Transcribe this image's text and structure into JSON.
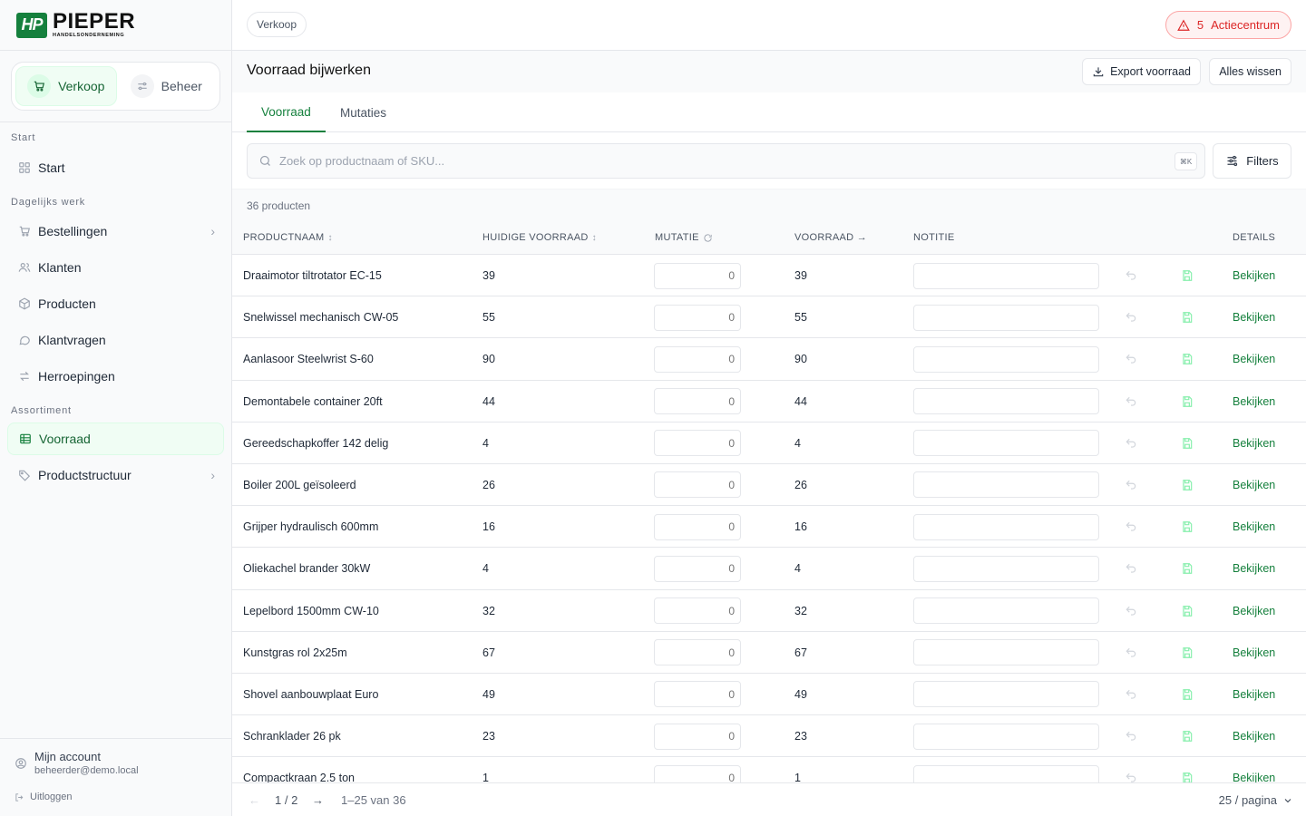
{
  "brand": {
    "mark": "HP",
    "name": "PIEPER",
    "sub": "HANDELSONDERNEMING"
  },
  "modes": [
    {
      "label": "Verkoop",
      "icon": "cart-icon",
      "active": true
    },
    {
      "label": "Beheer",
      "icon": "sliders-icon",
      "active": false
    }
  ],
  "nav": {
    "start_label": "Start",
    "start_item": "Start",
    "daily_label": "Dagelijks werk",
    "daily": [
      "Bestellingen",
      "Klanten",
      "Producten",
      "Klantvragen",
      "Herroepingen"
    ],
    "assort_label": "Assortiment",
    "assort": [
      "Voorraad",
      "Productstructuur"
    ]
  },
  "account": {
    "name": "Mijn account",
    "email": "beheerder@demo.local",
    "logout": "Uitloggen"
  },
  "topbar": {
    "breadcrumb": "Verkoop",
    "alert_count": "5",
    "alert_label": "Actiecentrum"
  },
  "page": {
    "title": "Voorraad bijwerken",
    "export_label": "Export voorraad",
    "clear_label": "Alles wissen"
  },
  "tabs": [
    "Voorraad",
    "Mutaties"
  ],
  "search": {
    "placeholder": "Zoek op productnaam of SKU...",
    "shortcut": "⌘K",
    "filters_label": "Filters"
  },
  "count_label": "36 producten",
  "columns": {
    "name": "PRODUCTNAAM",
    "stock": "HUIDIGE VOORRAAD",
    "mutation": "MUTATIE",
    "result": "VOORRAAD →",
    "note": "NOTITIE",
    "details": "DETAILS"
  },
  "rows": [
    {
      "name": "Draaimotor tiltrotator EC-15",
      "stock": "39",
      "mutation": "0",
      "result": "39"
    },
    {
      "name": "Snelwissel mechanisch CW-05",
      "stock": "55",
      "mutation": "0",
      "result": "55"
    },
    {
      "name": "Aanlasoor Steelwrist S-60",
      "stock": "90",
      "mutation": "0",
      "result": "90"
    },
    {
      "name": "Demontabele container 20ft",
      "stock": "44",
      "mutation": "0",
      "result": "44"
    },
    {
      "name": "Gereedschapkoffer 142 delig",
      "stock": "4",
      "mutation": "0",
      "result": "4"
    },
    {
      "name": "Boiler 200L geïsoleerd",
      "stock": "26",
      "mutation": "0",
      "result": "26"
    },
    {
      "name": "Grijper hydraulisch 600mm",
      "stock": "16",
      "mutation": "0",
      "result": "16"
    },
    {
      "name": "Oliekachel brander 30kW",
      "stock": "4",
      "mutation": "0",
      "result": "4"
    },
    {
      "name": "Lepelbord 1500mm CW-10",
      "stock": "32",
      "mutation": "0",
      "result": "32"
    },
    {
      "name": "Kunstgras rol 2x25m",
      "stock": "67",
      "mutation": "0",
      "result": "67"
    },
    {
      "name": "Shovel aanbouwplaat Euro",
      "stock": "49",
      "mutation": "0",
      "result": "49"
    },
    {
      "name": "Schranklader 26 pk",
      "stock": "23",
      "mutation": "0",
      "result": "23"
    },
    {
      "name": "Compactkraan 2.5 ton",
      "stock": "1",
      "mutation": "0",
      "result": "1"
    }
  ],
  "row_link": "Bekijken",
  "pagination": {
    "page": "1 / 2",
    "range": "1–25 van 36",
    "per_page": "25 / pagina"
  },
  "colors": {
    "accent": "#15803d",
    "danger": "#dc2626"
  }
}
